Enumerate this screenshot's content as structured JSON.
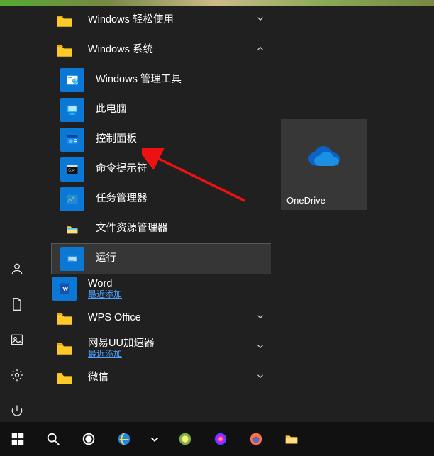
{
  "list": {
    "items": [
      {
        "label": "Windows 轻松使用",
        "kind": "folder",
        "chev": "down"
      },
      {
        "label": "Windows 系统",
        "kind": "folder",
        "chev": "up"
      },
      {
        "label": "Windows 管理工具",
        "kind": "admintools",
        "indent": true
      },
      {
        "label": "此电脑",
        "kind": "thispc",
        "indent": true
      },
      {
        "label": "控制面板",
        "kind": "controlpanel",
        "indent": true
      },
      {
        "label": "命令提示符",
        "kind": "cmd",
        "indent": true
      },
      {
        "label": "任务管理器",
        "kind": "taskmanager",
        "indent": true
      },
      {
        "label": "文件资源管理器",
        "kind": "explorer",
        "indent": true
      },
      {
        "label": "运行",
        "kind": "run",
        "indent": true,
        "selected": true
      },
      {
        "label": "Word",
        "sub": "最近添加",
        "kind": "word"
      },
      {
        "label": "WPS Office",
        "kind": "folder",
        "chev": "down"
      },
      {
        "label": "网易UU加速器",
        "sub": "最近添加",
        "kind": "folder",
        "chev": "down"
      },
      {
        "label": "微信",
        "kind": "folder",
        "chev": "down"
      }
    ]
  },
  "tile": {
    "label": "OneDrive"
  },
  "rail": {
    "user": "user-icon",
    "documents": "documents-icon",
    "pictures": "pictures-icon",
    "settings": "settings-icon",
    "power": "power-icon"
  },
  "taskbar": {
    "items": [
      "start",
      "search",
      "cortana",
      "ie",
      "edge",
      "360",
      "color",
      "firefox",
      "explorer"
    ]
  }
}
